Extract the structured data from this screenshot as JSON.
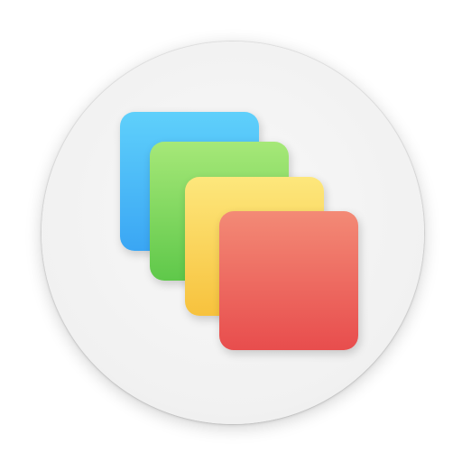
{
  "icon": {
    "name": "stacked-cards-app-icon",
    "background": {
      "shape": "circle",
      "color": "#f1f1f1"
    },
    "layers": [
      {
        "name": "blue-card",
        "colors": [
          "#5fd0fb",
          "#3aa6f4"
        ]
      },
      {
        "name": "green-card",
        "colors": [
          "#a6e878",
          "#5fc84a"
        ]
      },
      {
        "name": "yellow-card",
        "colors": [
          "#fde77c",
          "#f7c23d"
        ]
      },
      {
        "name": "red-card",
        "colors": [
          "#f38a76",
          "#e84d4d"
        ]
      }
    ]
  }
}
